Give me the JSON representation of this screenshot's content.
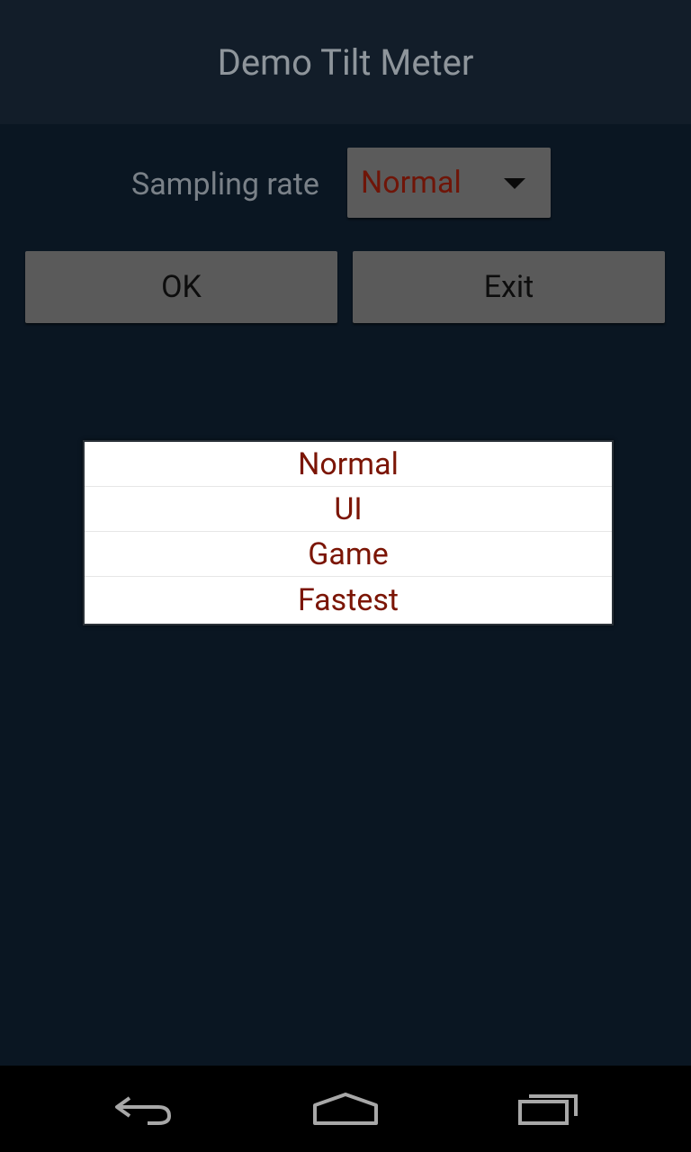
{
  "app": {
    "title": "Demo Tilt Meter"
  },
  "form": {
    "sampling_label": "Sampling rate",
    "sampling_selected": "Normal",
    "ok_label": "OK",
    "exit_label": "Exit"
  },
  "dropdown": {
    "options": [
      "Normal",
      "UI",
      "Game",
      "Fastest"
    ]
  },
  "navigation": {
    "back_icon": "back-icon",
    "home_icon": "home-icon",
    "recents_icon": "recents-icon"
  },
  "colors": {
    "title_bar": "#121d29",
    "background": "#0b1723",
    "option_text": "#7b1505",
    "button": "#5a5a5a"
  }
}
